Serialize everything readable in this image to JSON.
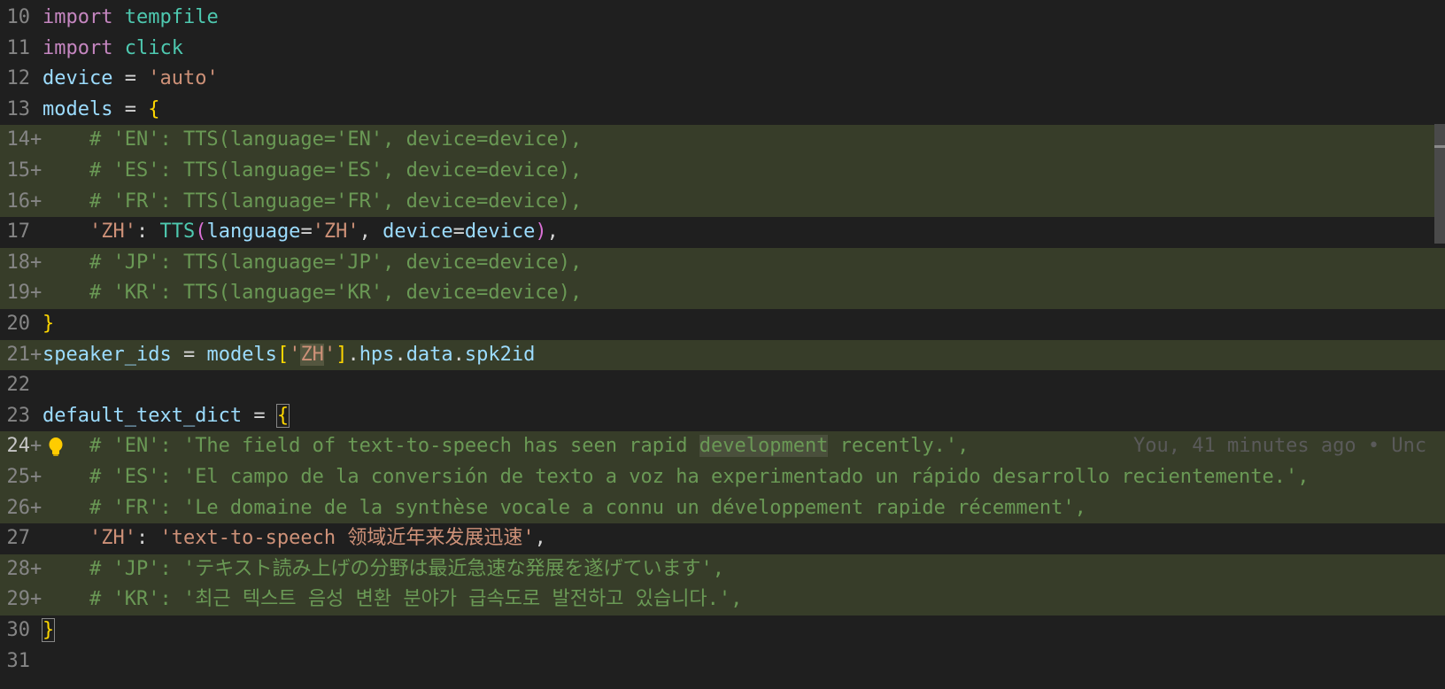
{
  "editor": {
    "lines": [
      {
        "num": "10",
        "added": false,
        "code": [
          [
            "kw",
            "import"
          ],
          [
            "punc",
            " "
          ],
          [
            "mod",
            "tempfile"
          ]
        ]
      },
      {
        "num": "11",
        "added": false,
        "code": [
          [
            "kw",
            "import"
          ],
          [
            "punc",
            " "
          ],
          [
            "mod",
            "click"
          ]
        ]
      },
      {
        "num": "12",
        "added": false,
        "code": [
          [
            "var",
            "device"
          ],
          [
            "punc",
            " = "
          ],
          [
            "str",
            "'auto'"
          ]
        ]
      },
      {
        "num": "13",
        "added": false,
        "code": [
          [
            "var",
            "models"
          ],
          [
            "punc",
            " = "
          ],
          [
            "brace",
            "{"
          ]
        ]
      },
      {
        "num": "14",
        "added": true,
        "code": [
          [
            "punc",
            "    "
          ],
          [
            "cmt",
            "# 'EN': TTS(language='EN', device=device),"
          ]
        ]
      },
      {
        "num": "15",
        "added": true,
        "code": [
          [
            "punc",
            "    "
          ],
          [
            "cmt",
            "# 'ES': TTS(language='ES', device=device),"
          ]
        ]
      },
      {
        "num": "16",
        "added": true,
        "code": [
          [
            "punc",
            "    "
          ],
          [
            "cmt",
            "# 'FR': TTS(language='FR', device=device),"
          ]
        ]
      },
      {
        "num": "17",
        "added": false,
        "code": [
          [
            "punc",
            "    "
          ],
          [
            "str",
            "'ZH'"
          ],
          [
            "punc",
            ": "
          ],
          [
            "fn",
            "TTS"
          ],
          [
            "paren",
            "("
          ],
          [
            "var",
            "language"
          ],
          [
            "punc",
            "="
          ],
          [
            "str",
            "'ZH'"
          ],
          [
            "punc",
            ", "
          ],
          [
            "var",
            "device"
          ],
          [
            "punc",
            "="
          ],
          [
            "var",
            "device"
          ],
          [
            "paren",
            ")"
          ],
          [
            "punc",
            ","
          ]
        ]
      },
      {
        "num": "18",
        "added": true,
        "code": [
          [
            "punc",
            "    "
          ],
          [
            "cmt",
            "# 'JP': TTS(language='JP', device=device),"
          ]
        ]
      },
      {
        "num": "19",
        "added": true,
        "code": [
          [
            "punc",
            "    "
          ],
          [
            "cmt",
            "# 'KR': TTS(language='KR', device=device),"
          ]
        ]
      },
      {
        "num": "20",
        "added": false,
        "code": [
          [
            "brace",
            "}"
          ]
        ]
      },
      {
        "num": "21",
        "added": true,
        "code": [
          [
            "var",
            "speaker_ids"
          ],
          [
            "punc",
            " = "
          ],
          [
            "var",
            "models"
          ],
          [
            "brace",
            "["
          ],
          [
            "str",
            "'"
          ],
          [
            "strhl",
            "ZH"
          ],
          [
            "str",
            "'"
          ],
          [
            "brace",
            "]"
          ],
          [
            "punc",
            "."
          ],
          [
            "var",
            "hps"
          ],
          [
            "punc",
            "."
          ],
          [
            "var",
            "data"
          ],
          [
            "punc",
            "."
          ],
          [
            "var",
            "spk2id"
          ]
        ]
      },
      {
        "num": "22",
        "added": false,
        "code": []
      },
      {
        "num": "23",
        "added": false,
        "code": [
          [
            "var",
            "default_text_dict"
          ],
          [
            "punc",
            " = "
          ],
          [
            "bracebox",
            "{"
          ]
        ]
      },
      {
        "num": "24",
        "added": true,
        "active": true,
        "code": [
          [
            "punc",
            "    "
          ],
          [
            "cmt",
            "# 'EN': 'The field of text-to-speech has seen rapid "
          ],
          [
            "cmthl",
            "development"
          ],
          [
            "cmt",
            " recently.',"
          ]
        ],
        "blame": "You, 41 minutes ago • Unc"
      },
      {
        "num": "25",
        "added": true,
        "code": [
          [
            "punc",
            "    "
          ],
          [
            "cmt",
            "# 'ES': 'El campo de la conversión de texto a voz ha experimentado un rápido desarrollo recientemente.',"
          ]
        ]
      },
      {
        "num": "26",
        "added": true,
        "code": [
          [
            "punc",
            "    "
          ],
          [
            "cmt",
            "# 'FR': 'Le domaine de la synthèse vocale a connu un développement rapide récemment',"
          ]
        ]
      },
      {
        "num": "27",
        "added": false,
        "code": [
          [
            "punc",
            "    "
          ],
          [
            "str",
            "'ZH'"
          ],
          [
            "punc",
            ": "
          ],
          [
            "str",
            "'text-to-speech 领域近年来发展迅速'"
          ],
          [
            "punc",
            ","
          ]
        ]
      },
      {
        "num": "28",
        "added": true,
        "code": [
          [
            "punc",
            "    "
          ],
          [
            "cmt",
            "# 'JP': 'テキスト読み上げの分野は最近急速な発展を遂げています',"
          ]
        ]
      },
      {
        "num": "29",
        "added": true,
        "code": [
          [
            "punc",
            "    "
          ],
          [
            "cmt",
            "# 'KR': '최근 텍스트 음성 변환 분야가 급속도로 발전하고 있습니다.',"
          ]
        ]
      },
      {
        "num": "30",
        "added": false,
        "code": [
          [
            "bracebox",
            "}"
          ]
        ]
      },
      {
        "num": "31",
        "added": false,
        "code": []
      }
    ],
    "colors": {
      "background": "#1f1f1f",
      "added_line": "#373d29",
      "keyword": "#c586c0",
      "string": "#ce9178",
      "comment": "#6a9955",
      "variable": "#9cdcfe",
      "brace": "#ffd700"
    },
    "icons": {
      "lightbulb": "lightbulb-icon"
    }
  }
}
